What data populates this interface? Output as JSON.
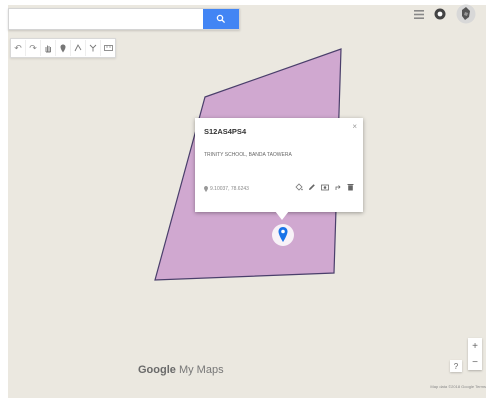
{
  "search": {
    "value": "",
    "placeholder": ""
  },
  "toolbar": {
    "tools": [
      {
        "name": "undo-icon",
        "glyph": "↶"
      },
      {
        "name": "redo-icon",
        "glyph": "↷"
      },
      {
        "name": "hand-icon",
        "glyph": "✋"
      },
      {
        "name": "add-marker-icon",
        "glyph": "📍"
      },
      {
        "name": "draw-line-icon",
        "glyph": "✎"
      },
      {
        "name": "directions-icon",
        "glyph": "Y"
      },
      {
        "name": "ruler-icon",
        "glyph": "▭"
      }
    ]
  },
  "popup": {
    "title": "S12AS4PS4",
    "description": "TRINITY SCHOOL, BANDA TAOWERA",
    "coordinates": "9.10037, 78.6243",
    "close": "×"
  },
  "zoom": {
    "in": "+",
    "out": "−"
  },
  "help": "?",
  "brand": {
    "google": "Google",
    "product": " My Maps"
  },
  "footer": "Map data ©2018 Google  Terms",
  "colors": {
    "map_background": "#ebe8e0",
    "polygon_fill": "#d0a8d0",
    "polygon_stroke": "#4a3f6b",
    "marker": "#1a73e8",
    "search_button": "#4285f4"
  }
}
